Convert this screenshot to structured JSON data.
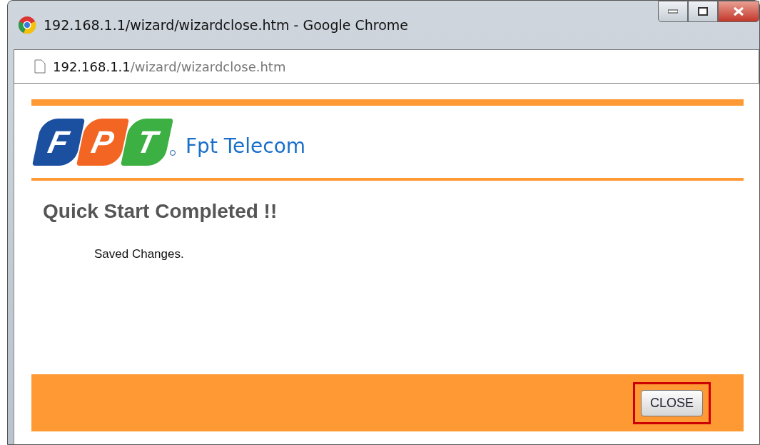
{
  "window": {
    "title": "192.168.1.1/wizard/wizardclose.htm - Google Chrome"
  },
  "address_bar": {
    "host": "192.168.1.1",
    "path": "/wizard/wizardclose.htm"
  },
  "logo": {
    "letters": [
      "F",
      "P",
      "T"
    ],
    "brand": "Fpt Telecom"
  },
  "heading": "Quick Start Completed !!",
  "message": "Saved Changes.",
  "footer": {
    "button": "CLOSE",
    "highlighted": true
  }
}
